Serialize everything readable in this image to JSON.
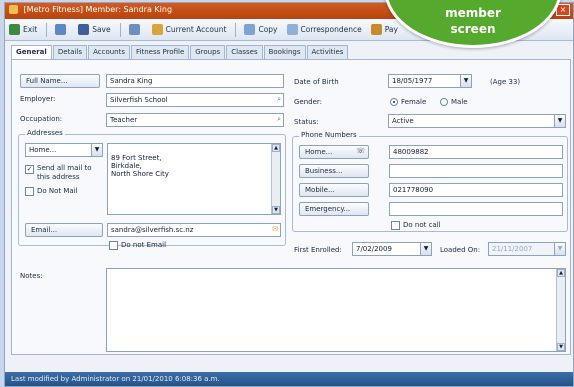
{
  "window": {
    "title": "[Metro Fitness] Member: Sandra King",
    "close_label": "×"
  },
  "toolbar": {
    "items": [
      {
        "label": "Exit",
        "icon": "exit-icon"
      },
      {
        "label": "",
        "icon": "new-icon"
      },
      {
        "label": "Save",
        "icon": "save-icon"
      },
      {
        "label": "",
        "icon": "link-icon"
      },
      {
        "label": "Current Account",
        "icon": "account-icon"
      },
      {
        "label": "Copy",
        "icon": "copy-icon"
      },
      {
        "label": "Correspondence",
        "icon": "correspondence-icon"
      },
      {
        "label": "Pay",
        "icon": "pay-icon"
      }
    ]
  },
  "tabs": [
    "General",
    "Details",
    "Accounts",
    "Fitness Profile",
    "Groups",
    "Classes",
    "Bookings",
    "Activities"
  ],
  "left": {
    "full_name_button": "Full Name...",
    "full_name_value": "Sandra King",
    "employer_label": "Employer:",
    "employer_value": "Silverfish School",
    "occupation_label": "Occupation:",
    "occupation_value": "Teacher",
    "addresses_title": "Addresses",
    "address_type": "Home...",
    "address_value": "89 Fort Street,\nBirkdale,\nNorth Shore City",
    "send_mail_label": "Send all mail to this address",
    "do_not_mail_label": "Do Not Mail",
    "email_button": "Email...",
    "email_value": "sandra@silverfish.sc.nz",
    "do_not_email_label": "Do not Email"
  },
  "right": {
    "dob_label": "Date of Birth",
    "dob_value": "18/05/1977",
    "age_text": "(Age 33)",
    "gender_label": "Gender:",
    "gender_female": "Female",
    "gender_male": "Male",
    "status_label": "Status:",
    "status_value": "Active",
    "phone_title": "Phone Numbers",
    "home_button": "Home...",
    "home_value": "48009882",
    "business_button": "Business...",
    "business_value": "",
    "mobile_button": "Mobile...",
    "mobile_value": "021778090",
    "emergency_button": "Emergency...",
    "emergency_value": "",
    "do_not_call_label": "Do not call",
    "first_enrolled_label": "First Enrolled:",
    "first_enrolled_value": "7/02/2009",
    "loaded_on_label": "Loaded On:",
    "loaded_on_value": "21/11/2007"
  },
  "notes": {
    "label": "Notes:",
    "value": ""
  },
  "status_bar": "Last modified by Administrator on 21/01/2010 6:08:36 a.m.",
  "badge": {
    "line1": "member",
    "line2": "screen",
    "color": "#55a92c"
  }
}
